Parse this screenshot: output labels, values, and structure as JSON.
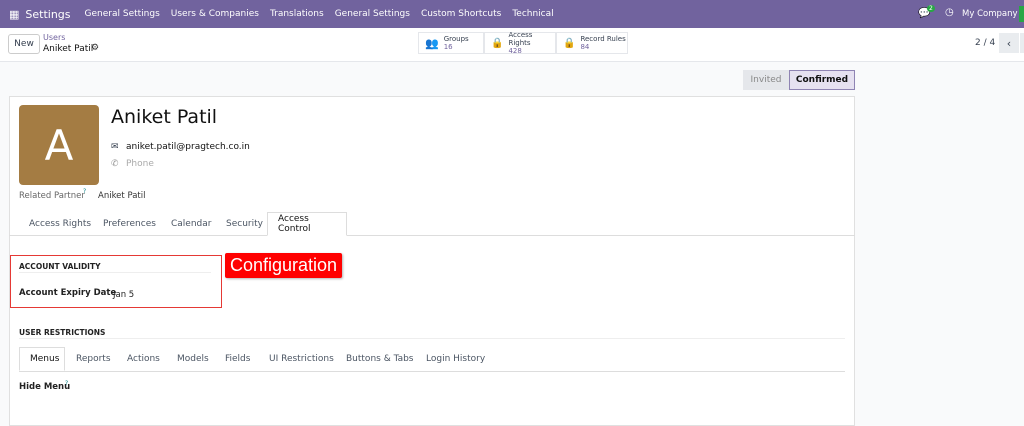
{
  "navbar": {
    "app": "Settings",
    "menu": [
      "General Settings",
      "Users & Companies",
      "Translations",
      "General Settings",
      "Custom Shortcuts",
      "Technical"
    ],
    "chat_badge": "2",
    "company": "My Company"
  },
  "control": {
    "new": "New",
    "breadcrumb": "Users",
    "record": "Aniket Patil",
    "pager": "2 / 4",
    "stats": [
      {
        "label": "Groups",
        "value": "16"
      },
      {
        "label": "Access Rights",
        "value": "428"
      },
      {
        "label": "Record Rules",
        "value": "84"
      }
    ]
  },
  "status": {
    "invited": "Invited",
    "confirmed": "Confirmed"
  },
  "form": {
    "avatar_letter": "A",
    "avatar_color": "#a47c43",
    "name": "Aniket Patil",
    "email": "aniket.patil@pragtech.co.in",
    "phone_placeholder": "Phone",
    "related_partner_label": "Related Partner",
    "help": "?",
    "related_partner": "Aniket Patil",
    "tabs": [
      "Access Rights",
      "Preferences",
      "Calendar",
      "Security",
      "Access Control"
    ],
    "account_validity": "ACCOUNT VALIDITY",
    "expiry_label": "Account Expiry Date",
    "expiry_value": "Jan 5",
    "annotation": "Configuration",
    "user_restrictions": "USER RESTRICTIONS",
    "sub_tabs": [
      "Menus",
      "Reports",
      "Actions",
      "Models",
      "Fields",
      "UI Restrictions",
      "Buttons & Tabs",
      "Login History"
    ],
    "hide_menu": "Hide Menu"
  }
}
